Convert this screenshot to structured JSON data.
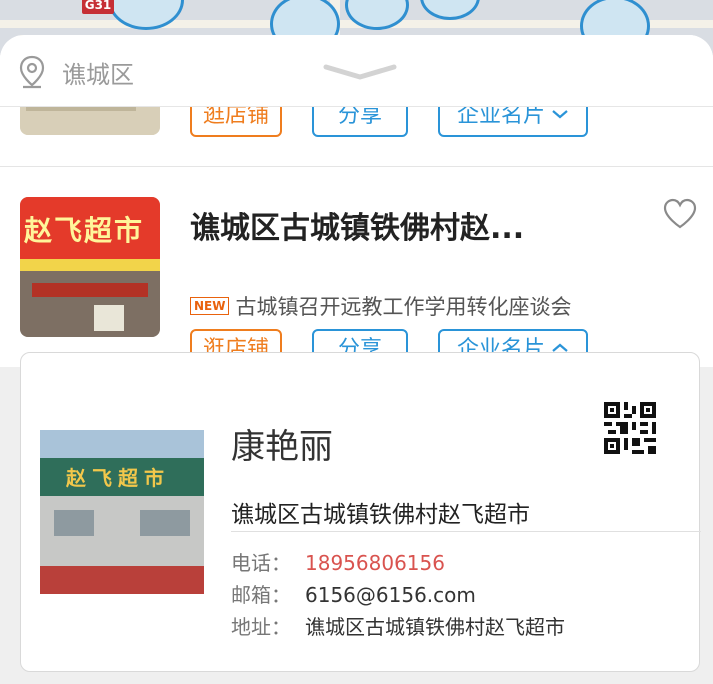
{
  "map": {
    "highway_label": "G31"
  },
  "header": {
    "location_icon": "location-pin-icon",
    "location": "谯城区",
    "handle_icon": "chevron-down-icon"
  },
  "stores": [
    {
      "buttons": {
        "visit": "逛店铺",
        "share": "分享",
        "card": "企业名片",
        "card_chevron": "chevron-down-icon"
      }
    },
    {
      "name": "谯城区古城镇铁佛村赵...",
      "favorite_icon": "heart-outline-icon",
      "news_badge": "NEW",
      "news_text": "古城镇召开远教工作学用转化座谈会",
      "thumb_sign": "赵飞超市",
      "buttons": {
        "visit": "逛店铺",
        "share": "分享",
        "card": "企业名片",
        "card_chevron": "chevron-up-icon"
      }
    }
  ],
  "business_card": {
    "name": "康艳丽",
    "company": "谯城区古城镇铁佛村赵飞超市",
    "photo_sign": "赵飞超市",
    "qr_icon": "qr-code-icon",
    "rows": [
      {
        "label": "电话：",
        "value": "18956806156"
      },
      {
        "label": "邮箱：",
        "value": "6156@6156.com"
      },
      {
        "label": "地址：",
        "value": "谯城区古城镇铁佛村赵飞超市"
      }
    ]
  },
  "colors": {
    "accent_blue": "#2a94d8",
    "accent_orange": "#ef7d1e",
    "phone_red": "#d9534f"
  }
}
